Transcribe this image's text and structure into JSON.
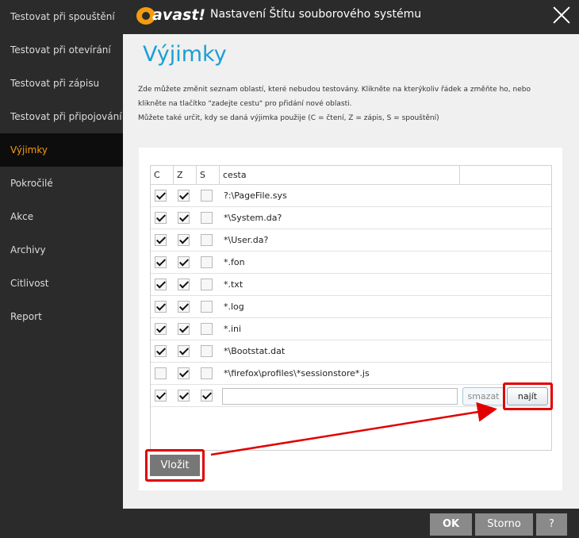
{
  "sidebar": {
    "items": [
      {
        "label": "Testovat při spouštění"
      },
      {
        "label": "Testovat při otevírání"
      },
      {
        "label": "Testovat při zápisu"
      },
      {
        "label": "Testovat při připojování"
      },
      {
        "label": "Výjimky",
        "active": true
      },
      {
        "label": "Pokročilé"
      },
      {
        "label": "Akce"
      },
      {
        "label": "Archivy"
      },
      {
        "label": "Citlivost"
      },
      {
        "label": "Report"
      }
    ]
  },
  "titlebar": {
    "logo_text": "avast!",
    "title": "Nastavení Štítu souborového systému"
  },
  "main": {
    "heading": "Výjimky",
    "description_lines": [
      "Zde můžete změnit seznam oblastí, které nebudou testovány. Klikněte na kterýkoliv řádek a změňte ho, nebo",
      "klikněte na tlačítko \"zadejte cestu\" pro přidání nové oblasti.",
      "Můžete také určit, kdy se daná výjimka použije (C = čtení, Z = zápis, S = spouštění)"
    ],
    "table": {
      "headers": [
        "C",
        "Z",
        "S",
        "cesta"
      ],
      "rows": [
        {
          "c": true,
          "z": true,
          "s": false,
          "path": "?:\\PageFile.sys"
        },
        {
          "c": true,
          "z": true,
          "s": false,
          "path": "*\\System.da?"
        },
        {
          "c": true,
          "z": true,
          "s": false,
          "path": "*\\User.da?"
        },
        {
          "c": true,
          "z": true,
          "s": false,
          "path": "*.fon"
        },
        {
          "c": true,
          "z": true,
          "s": false,
          "path": "*.txt"
        },
        {
          "c": true,
          "z": true,
          "s": false,
          "path": "*.log"
        },
        {
          "c": true,
          "z": true,
          "s": false,
          "path": "*.ini"
        },
        {
          "c": true,
          "z": true,
          "s": false,
          "path": "*\\Bootstat.dat"
        },
        {
          "c": false,
          "z": true,
          "s": false,
          "path": "*\\firefox\\profiles\\*sessionstore*.js"
        }
      ],
      "new_row": {
        "c": true,
        "z": true,
        "s": true,
        "path_value": ""
      },
      "delete_label": "smazat",
      "find_label": "najít"
    },
    "insert_label": "Vložit"
  },
  "footer": {
    "ok_label": "OK",
    "cancel_label": "Storno",
    "help_label": "?"
  },
  "colors": {
    "accent_heading": "#1a9fd4",
    "active_sidebar_text": "#f39c12",
    "annotation_red": "#e00000"
  }
}
